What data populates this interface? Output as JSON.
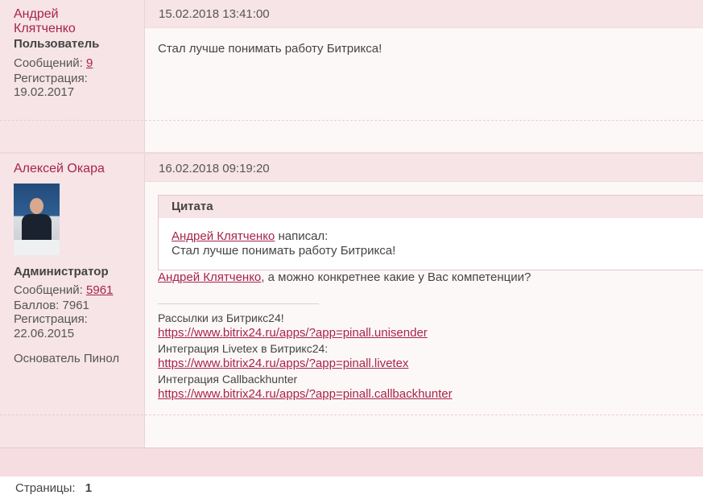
{
  "posts": [
    {
      "author": "Андрей Клятченко",
      "role": "Пользователь",
      "messages_label": "Сообщений:",
      "messages_count": "9",
      "registration_label": "Регистрация:",
      "registration_date": "19.02.2017",
      "date": "15.02.2018 13:41:00",
      "text": "Стал лучше понимать работу Битрикса!"
    },
    {
      "author": "Алексей Окара",
      "role": "Администратор",
      "messages_label": "Сообщений:",
      "messages_count": "5961",
      "points": "Баллов: 7961",
      "registration_label": "Регистрация:",
      "registration_date": "22.06.2015",
      "title": "Основатель Пинол",
      "date": "16.02.2018 09:19:20",
      "quote": {
        "title": "Цитата",
        "author_link": "Андрей Клятченко",
        "wrote": " написал:",
        "text": "Стал лучше понимать работу Битрикса!"
      },
      "reply_link": "Андрей Клятченко",
      "reply_text": ", а можно конкретнее какие у Вас компетенции?",
      "signature": [
        {
          "label": "Рассылки из Битрикс24!",
          "url": "https://www.bitrix24.ru/apps/?app=pinall.unisender"
        },
        {
          "label": "Интеграция Livetex в Битрикс24:",
          "url": "https://www.bitrix24.ru/apps/?app=pinall.livetex"
        },
        {
          "label": "Интеграция Callbackhunter",
          "url": "https://www.bitrix24.ru/apps/?app=pinall.callbackhunter"
        }
      ]
    }
  ],
  "pagination": {
    "label": "Страницы:",
    "current": "1"
  }
}
